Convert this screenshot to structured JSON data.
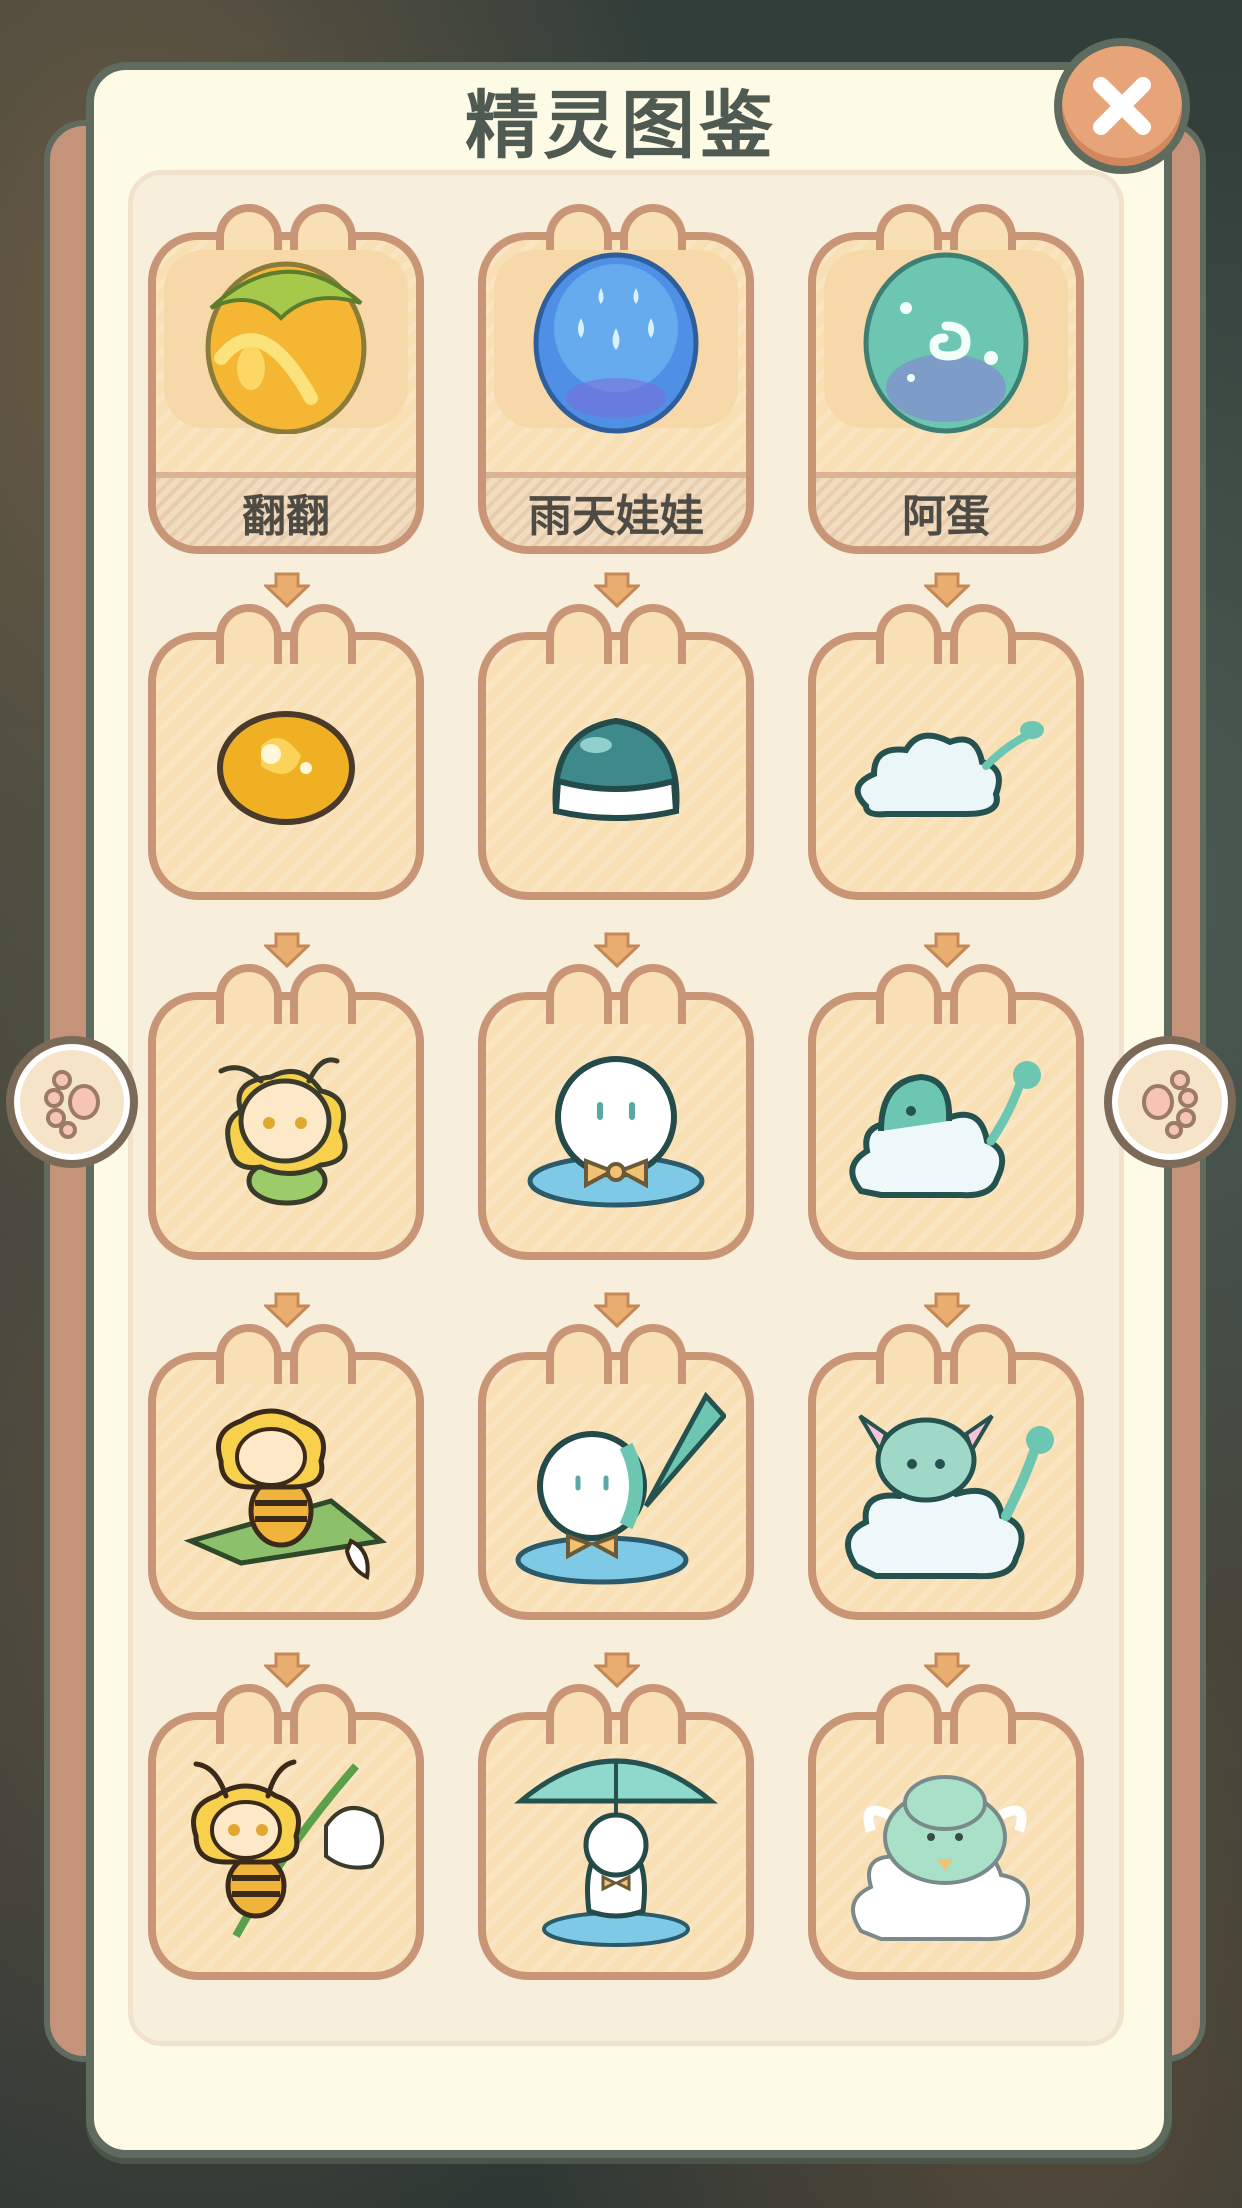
{
  "title": "精灵图鉴",
  "eggs": [
    {
      "name": "翻翻",
      "egg": "yellow-leaf-egg-icon"
    },
    {
      "name": "雨天娃娃",
      "egg": "blue-raindrop-egg-icon"
    },
    {
      "name": "阿蛋",
      "egg": "green-swirl-egg-icon"
    }
  ],
  "stages": [
    [
      "yellow-seed-icon",
      "teal-jelly-icon",
      "small-cloud-icon"
    ],
    [
      "fluffy-bug-icon",
      "bowtie-ghost-icon",
      "cloud-bird-icon"
    ],
    [
      "bee-on-leaf-icon",
      "ghost-with-umbrella-icon",
      "cloud-goat-icon"
    ],
    [
      "bee-with-lily-icon",
      "ghost-under-umbrella-icon",
      "fluffy-cloud-sheep-icon"
    ]
  ],
  "colors": {
    "frame": "#5f6b5e",
    "card_bg": "#f9dfb4",
    "card_border": "#c99577",
    "close_button": "#e8a479",
    "arrow": "#e9ad70"
  }
}
